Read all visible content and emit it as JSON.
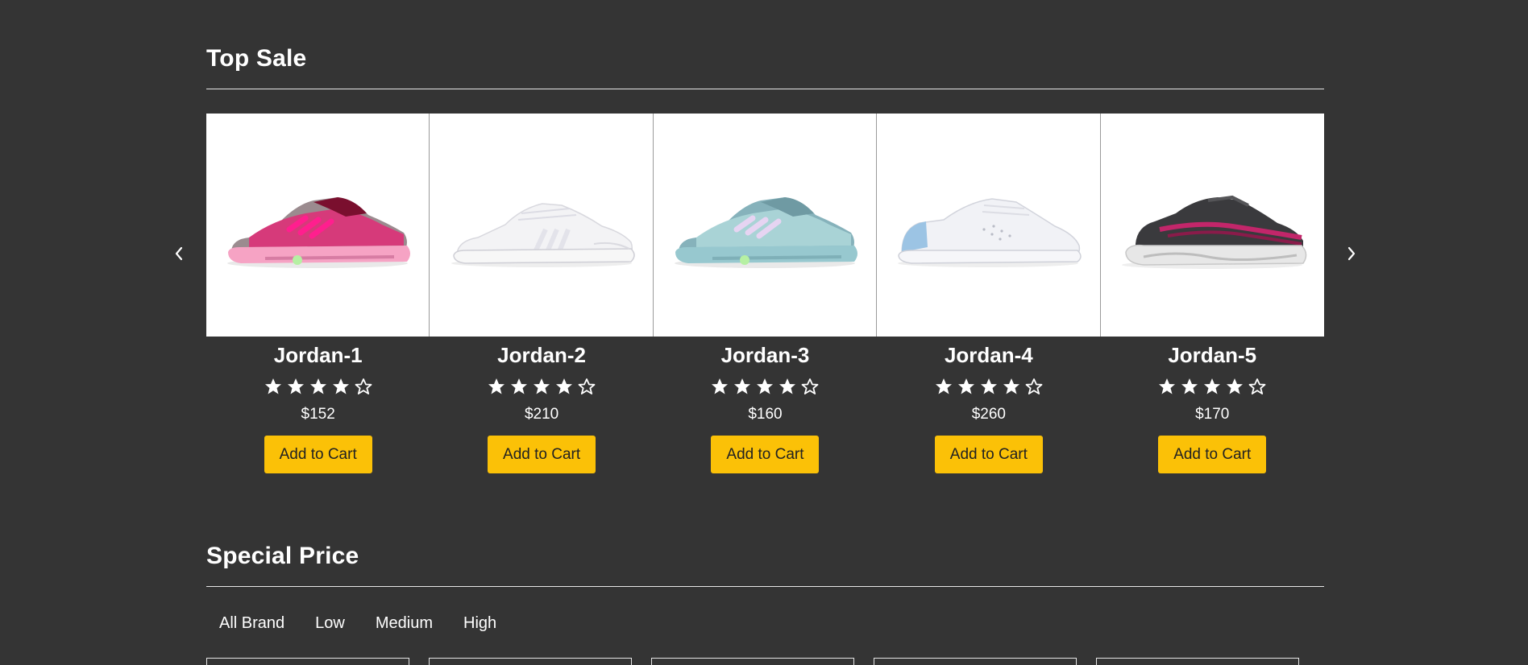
{
  "top_sale": {
    "title": "Top Sale",
    "products": [
      {
        "name": "Jordan-1",
        "price": "$152",
        "rating": 4,
        "button": "Add to Cart",
        "image": "pink-sneaker"
      },
      {
        "name": "Jordan-2",
        "price": "$210",
        "rating": 4,
        "button": "Add to Cart",
        "image": "white-shell-toe-sneaker"
      },
      {
        "name": "Jordan-3",
        "price": "$160",
        "rating": 4,
        "button": "Add to Cart",
        "image": "light-blue-sneaker"
      },
      {
        "name": "Jordan-4",
        "price": "$260",
        "rating": 4,
        "button": "Add to Cart",
        "image": "white-blue-heel-sneaker"
      },
      {
        "name": "Jordan-5",
        "price": "$170",
        "rating": 4,
        "button": "Add to Cart",
        "image": "black-pink-chunky-sneaker"
      }
    ]
  },
  "special_price": {
    "title": "Special Price",
    "filters": [
      "All Brand",
      "Low",
      "Medium",
      "High"
    ]
  },
  "colors": {
    "background": "#343434",
    "accent": "#fbc107",
    "text": "#ffffff"
  },
  "icons": {
    "prev": "chevron-left-icon",
    "next": "chevron-right-icon",
    "star_filled": "star-filled-icon",
    "star_empty": "star-outline-icon"
  }
}
